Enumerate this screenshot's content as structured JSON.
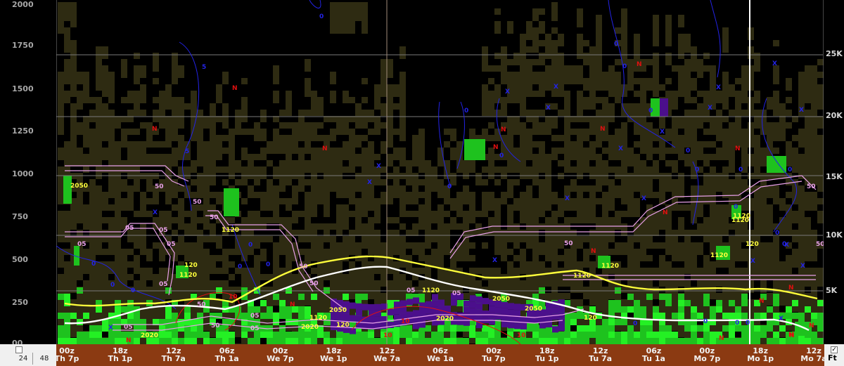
{
  "left_axis": {
    "ticks": [
      "2000",
      "1750",
      "1500",
      "1250",
      "1000",
      "750",
      "500",
      "250",
      "00"
    ]
  },
  "right_axis": {
    "ticks": [
      "25K",
      "20K",
      "15K",
      "10K",
      "5K"
    ]
  },
  "time_axis": {
    "labels": [
      {
        "top": "00z",
        "bot": "Th 7p"
      },
      {
        "top": "18z",
        "bot": "Th 1p"
      },
      {
        "top": "12z",
        "bot": "Th 7a"
      },
      {
        "top": "06z",
        "bot": "Th 1a"
      },
      {
        "top": "00z",
        "bot": "We 7p"
      },
      {
        "top": "18z",
        "bot": "We 1p"
      },
      {
        "top": "12z",
        "bot": "We 7a"
      },
      {
        "top": "06z",
        "bot": "We 1a"
      },
      {
        "top": "00z",
        "bot": "Tu 7p"
      },
      {
        "top": "18z",
        "bot": "Tu 1p"
      },
      {
        "top": "12z",
        "bot": "Tu 7a"
      },
      {
        "top": "06z",
        "bot": "Tu 1a"
      },
      {
        "top": "00z",
        "bot": "Mo 7p"
      },
      {
        "top": "18z",
        "bot": "Mo 1p"
      },
      {
        "top": "12z",
        "bot": "Mo 7a"
      }
    ]
  },
  "controls": {
    "hours_a": "24",
    "hours_b": "48",
    "units": "Ft",
    "checked_mark": "✓"
  },
  "colors": {
    "cloud": "#2e2b12",
    "green": "#1ec21e",
    "bright_green": "#24f024",
    "purple": "#4b0f8c",
    "yellow": "#ffff3c",
    "white": "#ffffff",
    "pink": "#e8a0e8",
    "blue": "#2323e6",
    "red": "#e01010",
    "timebar": "#8b3a12"
  },
  "plot_labels": {
    "north_marker": "N",
    "cross_marker": "X",
    "zero": "0",
    "five": "5",
    "five_pink": "05",
    "fifty": "50",
    "ten": "10",
    "threshold": "120",
    "combo_a": "2050",
    "combo_b": "2050",
    "t_120": "1120",
    "t_2020": "2020"
  }
}
